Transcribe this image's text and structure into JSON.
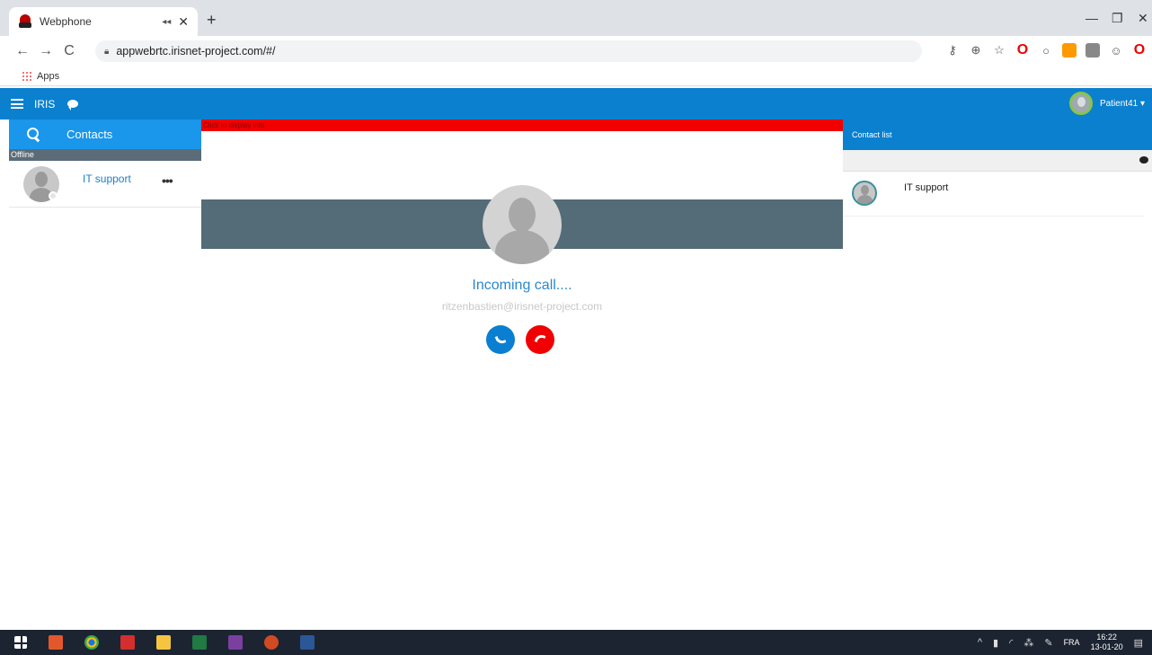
{
  "browser": {
    "tab_title": "Webphone",
    "tab_audio": "◂◂",
    "tab_close": "✕",
    "new_tab": "+",
    "url": "appwebrtc.irisnet-project.com/#/",
    "bookmarks_apps": "Apps",
    "win_minimize": "—",
    "win_maximize": "❐",
    "win_close": "✕"
  },
  "app": {
    "brand": "IRIS",
    "user_name": "Patient41 ▾"
  },
  "left_panel": {
    "search_label": "Contacts",
    "group_label": "Offline",
    "contacts": [
      {
        "name": "IT support",
        "more": "•••"
      }
    ]
  },
  "call": {
    "banner_text": "Click to display info",
    "status": "Incoming call....",
    "caller_email": "ritzenbastien@irisnet-project.com"
  },
  "right_panel": {
    "header": "Contact list",
    "contacts": [
      {
        "name": "IT support"
      }
    ]
  },
  "taskbar": {
    "time": "16:22",
    "date": "13-01-20",
    "language": "FRA"
  },
  "colors": {
    "header_blue": "#0a80cf",
    "accept": "#0a7fd2",
    "reject": "#f00000",
    "banner_red": "#f20000"
  }
}
